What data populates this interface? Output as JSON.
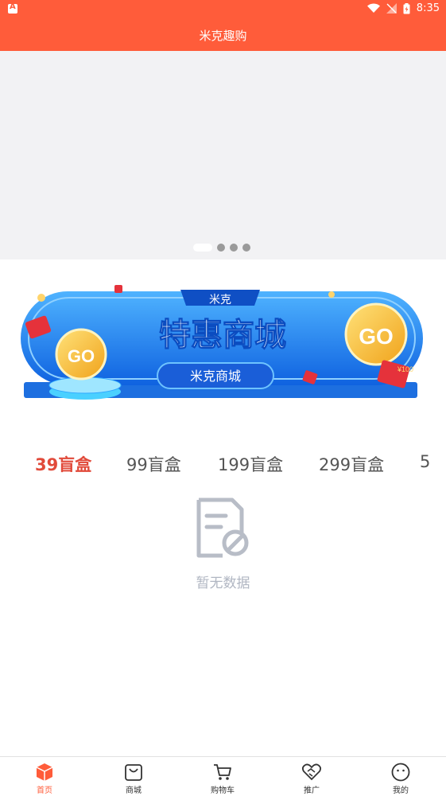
{
  "status_bar": {
    "time": "8:35",
    "app_icon": "a-icon"
  },
  "header": {
    "title": "米克趣购"
  },
  "carousel": {
    "dot_count": 4,
    "active_index": 0
  },
  "promo_banner": {
    "top_label": "米克",
    "title": "特惠商城",
    "button_label": "米克商城",
    "go_left": "GO",
    "go_right": "GO",
    "coupon_text": "¥100"
  },
  "tabs": [
    {
      "label": "39盲盒",
      "active": true
    },
    {
      "label": "99盲盒",
      "active": false
    },
    {
      "label": "199盲盒",
      "active": false
    },
    {
      "label": "299盲盒",
      "active": false
    },
    {
      "label": "5",
      "active": false
    }
  ],
  "empty_state": {
    "icon": "no-data-icon",
    "text": "暂无数据"
  },
  "bottom_nav": [
    {
      "label": "首页",
      "icon": "home-box-icon",
      "active": true
    },
    {
      "label": "商城",
      "icon": "shopping-bag-icon",
      "active": false
    },
    {
      "label": "购物车",
      "icon": "cart-icon",
      "active": false
    },
    {
      "label": "推广",
      "icon": "handshake-icon",
      "active": false
    },
    {
      "label": "我的",
      "icon": "face-icon",
      "active": false
    }
  ],
  "colors": {
    "primary": "#ff5c3a",
    "tab_active": "#e14a3a",
    "banner_blue": "#1e7ef0",
    "empty_gray": "#b0b6c2"
  }
}
